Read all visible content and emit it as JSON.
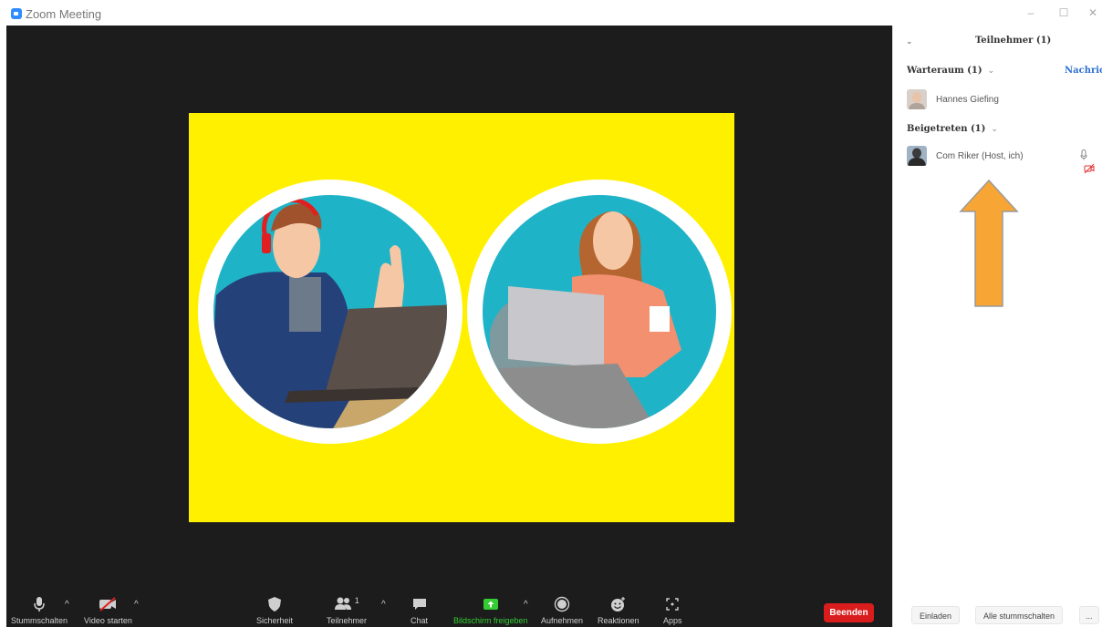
{
  "window": {
    "title": "Zoom Meeting",
    "controls": [
      "–",
      "☐",
      "✕"
    ]
  },
  "toolbar": {
    "mute_label": "Stummschalten",
    "video_label": "Video starten",
    "security_label": "Sicherheit",
    "participants_label": "Teilnehmer",
    "participants_count": "1",
    "chat_label": "Chat",
    "share_label": "Bildschirm freigeben",
    "record_label": "Aufnehmen",
    "reactions_label": "Reaktionen",
    "apps_label": "Apps",
    "end_label": "Beenden",
    "caret": "^"
  },
  "panel": {
    "collapse_glyph": "⌄",
    "title": "Teilnehmer (1)",
    "waiting": {
      "heading": "Warteraum (1)",
      "message_link": "Nachricht",
      "participants": [
        {
          "name": "Hannes Giefing"
        }
      ]
    },
    "joined": {
      "heading": "Beigetreten (1)",
      "participants": [
        {
          "name": "Com Riker (Host, ich)"
        }
      ]
    },
    "chevron": "⌄",
    "footer": {
      "invite_label": "Einladen",
      "mute_all_label": "Alle stummschalten",
      "more_label": "..."
    }
  },
  "colors": {
    "stage_bg": "#1c1c1c",
    "video_bg": "#fff000",
    "end_button": "#d91d1d",
    "share_green": "#33cc33",
    "accent_blue": "#2d6fd1",
    "arrow_orange": "#f7a534"
  },
  "icons": {
    "mute": "microphone-icon",
    "video": "video-off-icon",
    "security": "shield-icon",
    "participants": "people-icon",
    "chat": "chat-bubble-icon",
    "share": "share-screen-icon",
    "record": "record-icon",
    "reactions": "emoji-icon",
    "apps": "apps-icon"
  }
}
